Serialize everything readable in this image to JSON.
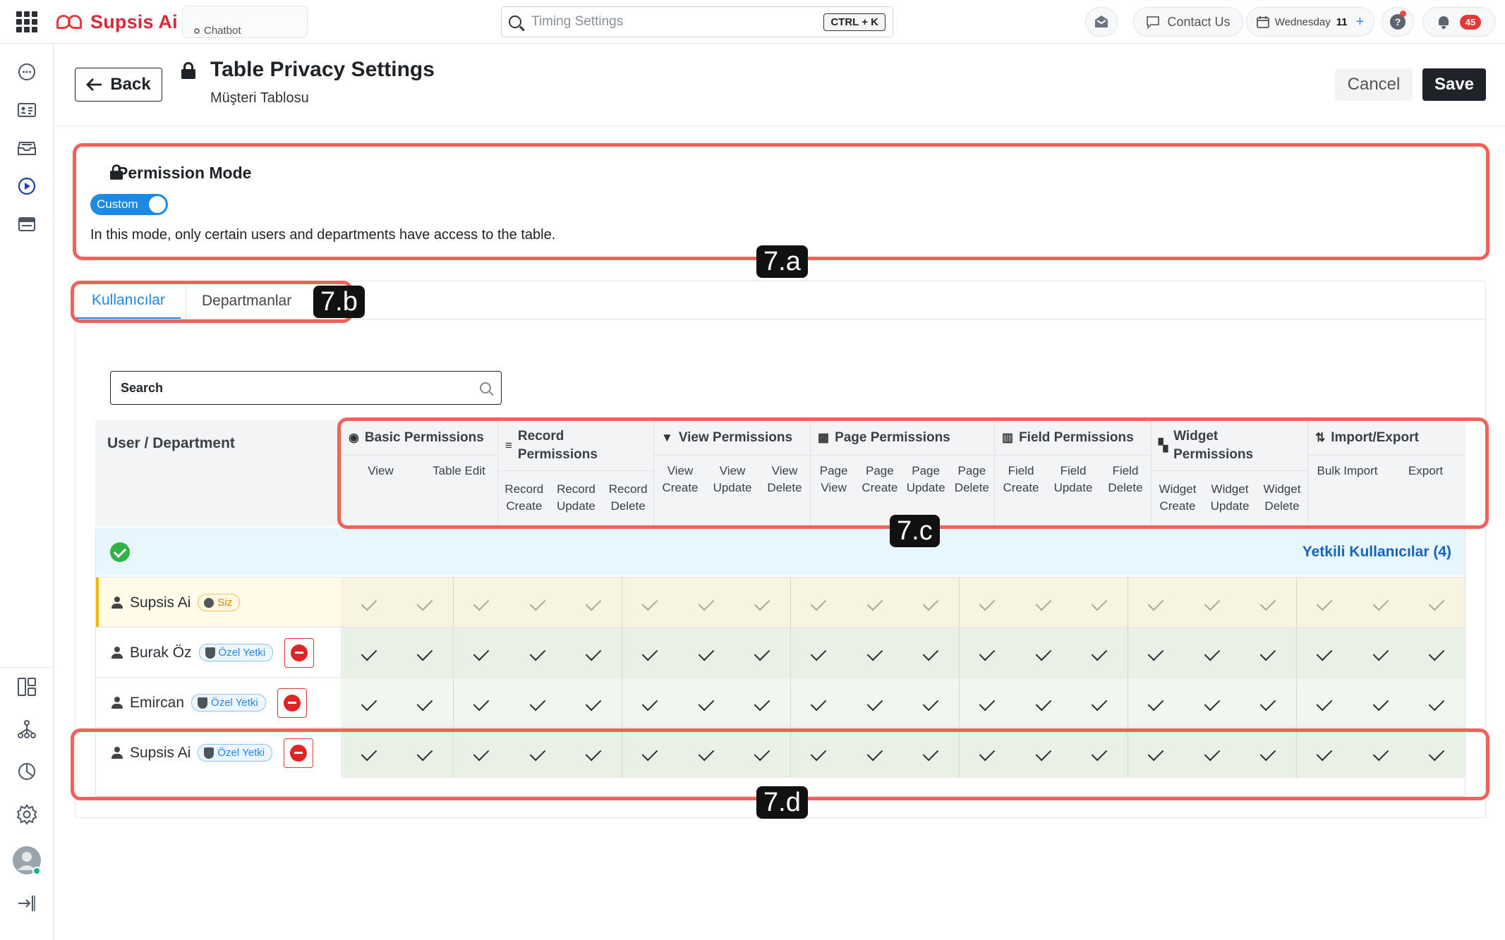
{
  "topbar": {
    "brand": "Supsis Ai",
    "chat_tab": "Chatbot",
    "search_placeholder": "Timing Settings",
    "shortcut": "CTRL + K",
    "contact": "Contact Us",
    "date_day": "Wednesday",
    "date_num": "11",
    "date_plus": "+",
    "help": "?",
    "notif_count": "45"
  },
  "sidebar": {
    "items": [
      "chat-bubble-icon",
      "contact-card-icon",
      "inbox-icon",
      "play-circle-icon",
      "browser-window-icon"
    ],
    "bottom": [
      "layout-icon",
      "network-icon",
      "clock-chart-icon",
      "settings-icon",
      "avatar",
      "logout-icon"
    ]
  },
  "header": {
    "back": "Back",
    "title": "Table Privacy Settings",
    "subtitle": "Müşteri Tablosu",
    "cancel": "Cancel",
    "save": "Save"
  },
  "permission_mode": {
    "title": "Permission Mode",
    "toggle": "Custom",
    "description": "In this mode, only certain users and departments have access to the table."
  },
  "tabs": [
    "Kullanıcılar",
    "Departmanlar"
  ],
  "search": {
    "placeholder": "Search"
  },
  "table": {
    "first_col": "User / Department",
    "groups": [
      {
        "icon": "eye-icon",
        "title": "Basic Permissions",
        "subs": [
          "View",
          "Table Edit"
        ]
      },
      {
        "icon": "edit-list-icon",
        "title": "Record Permissions",
        "subs": [
          "Record Create",
          "Record Update",
          "Record Delete"
        ]
      },
      {
        "icon": "filter-icon",
        "title": "View Permissions",
        "subs": [
          "View Create",
          "View Update",
          "View Delete"
        ]
      },
      {
        "icon": "dashboard-icon",
        "title": "Page Permissions",
        "subs": [
          "Page View",
          "Page Create",
          "Page Update",
          "Page Delete"
        ]
      },
      {
        "icon": "columns-icon",
        "title": "Field Permissions",
        "subs": [
          "Field Create",
          "Field Update",
          "Field Delete"
        ]
      },
      {
        "icon": "widget-icon",
        "title": "Widget Permissions",
        "subs": [
          "Widget Create",
          "Widget Update",
          "Widget Delete"
        ]
      },
      {
        "icon": "sort-arrows-icon",
        "title": "Import/Export",
        "subs": [
          "Bulk Import",
          "Export"
        ]
      }
    ],
    "banner": "Yetkili Kullanıcılar (4)",
    "rows": [
      {
        "name": "Supsis Ai",
        "badge": "Siz",
        "self": true
      },
      {
        "name": "Burak Öz",
        "badge": "Özel Yetki",
        "self": false
      },
      {
        "name": "Emircan",
        "badge": "Özel Yetki",
        "self": false
      },
      {
        "name": "Supsis Ai",
        "badge": "Özel Yetki",
        "self": false
      }
    ]
  },
  "annotations": [
    "7.a",
    "7.b",
    "7.c",
    "7.d"
  ],
  "colors": {
    "accent": "#1e88e5",
    "annotation": "#f0625a",
    "brand": "#d8293a",
    "danger": "#e53935"
  }
}
